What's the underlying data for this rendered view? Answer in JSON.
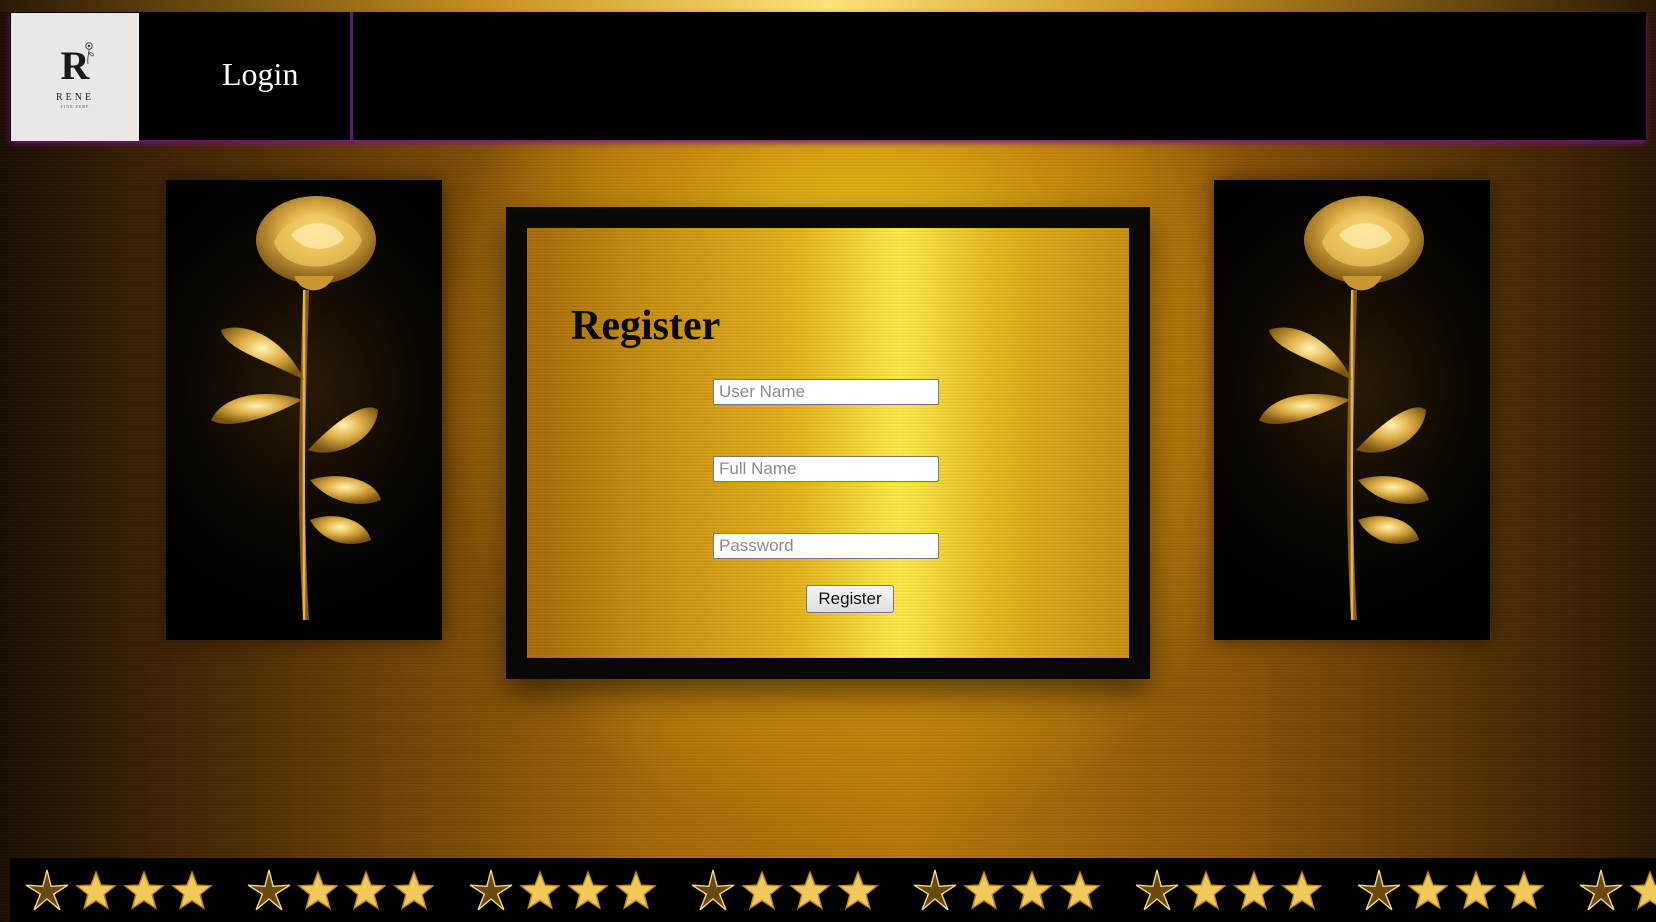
{
  "header": {
    "logo_letter": "R",
    "logo_name": "RENE",
    "logo_tagline": "FINE PERF",
    "login_label": "Login"
  },
  "register_form": {
    "title": "Register",
    "username_placeholder": "User Name",
    "fullname_placeholder": "Full Name",
    "password_placeholder": "Password",
    "submit_label": "Register"
  },
  "decor": {
    "left_panel_icon": "golden-rose-icon",
    "right_panel_icon": "golden-rose-icon",
    "footer_icon": "gold-star-icon"
  },
  "colors": {
    "header_bg": "#000000",
    "accent_purple": "#5b1a6a",
    "gold": "#e6b51e"
  }
}
